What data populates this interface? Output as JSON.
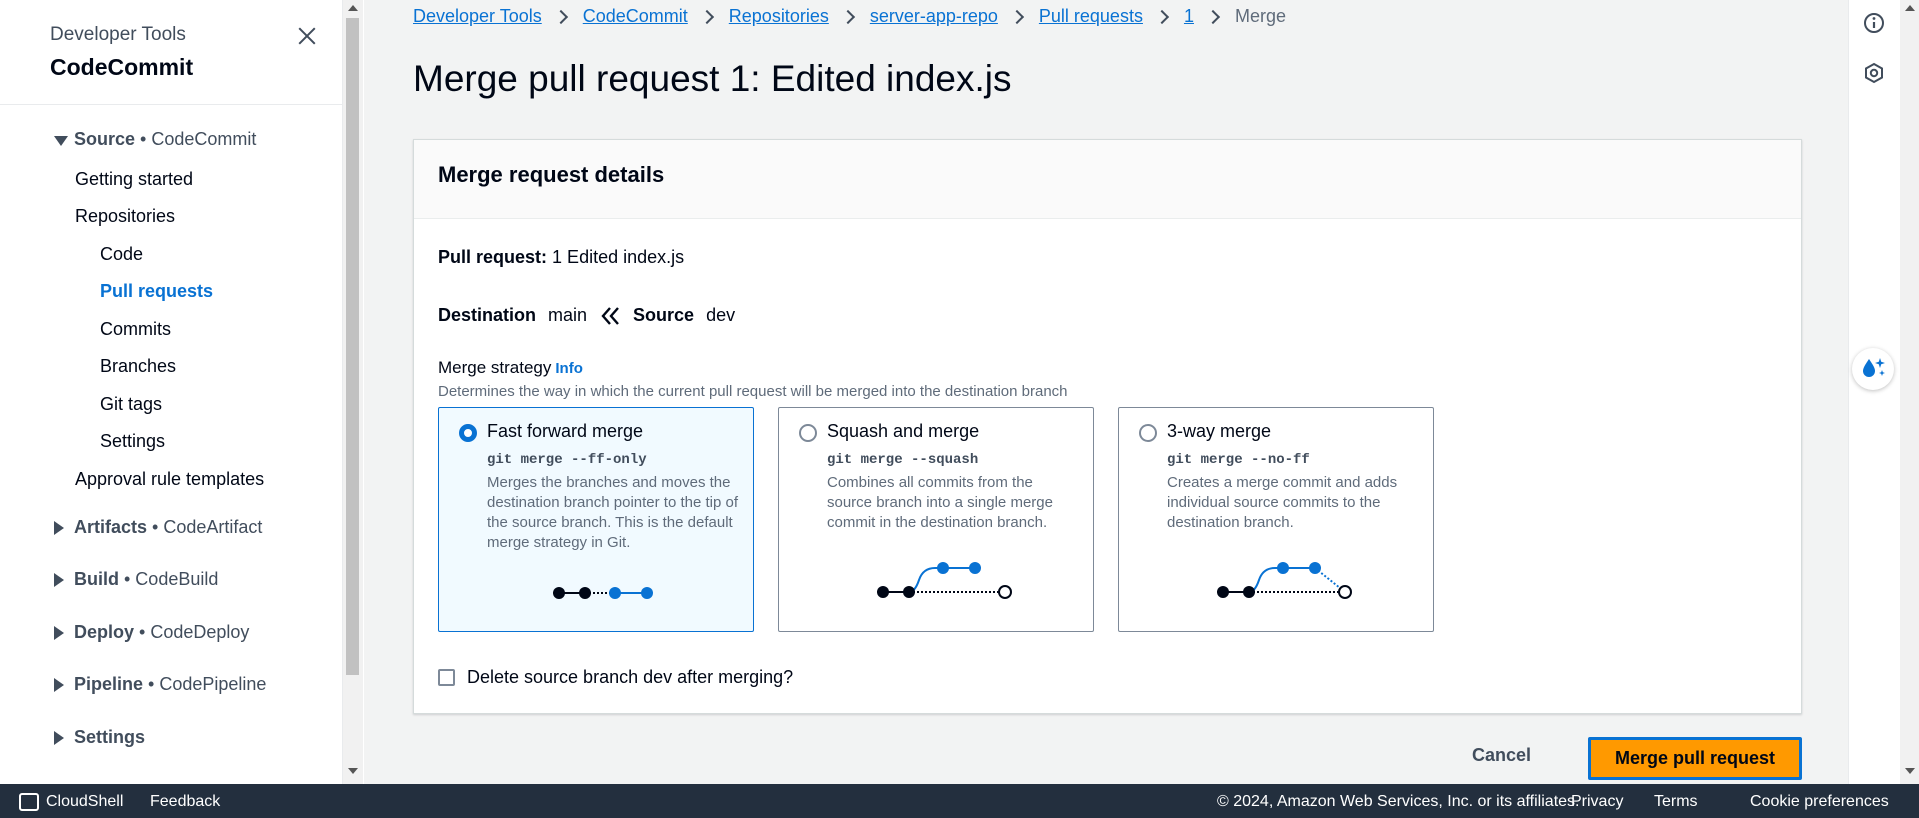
{
  "sidebar": {
    "super_title": "Developer Tools",
    "title": "CodeCommit",
    "source_section": {
      "label": "Source",
      "suffix": " • CodeCommit"
    },
    "items": [
      {
        "label": "Getting started"
      },
      {
        "label": "Repositories"
      },
      {
        "label": "Code"
      },
      {
        "label": "Pull requests"
      },
      {
        "label": "Commits"
      },
      {
        "label": "Branches"
      },
      {
        "label": "Git tags"
      },
      {
        "label": "Settings"
      },
      {
        "label": "Approval rule templates"
      }
    ],
    "sections": [
      {
        "label": "Artifacts",
        "suffix": " • CodeArtifact"
      },
      {
        "label": "Build",
        "suffix": " • CodeBuild"
      },
      {
        "label": "Deploy",
        "suffix": " • CodeDeploy"
      },
      {
        "label": "Pipeline",
        "suffix": " • CodePipeline"
      },
      {
        "label": "Settings",
        "suffix": ""
      }
    ]
  },
  "breadcrumb": [
    "Developer Tools",
    "CodeCommit",
    "Repositories",
    "server-app-repo",
    "Pull requests",
    "1"
  ],
  "breadcrumb_current": "Merge",
  "page_title": "Merge pull request 1: Edited index.js",
  "card": {
    "title": "Merge request details",
    "pull_request_label": "Pull request:",
    "pull_request_value": "1 Edited index.js",
    "destination_label": "Destination",
    "destination_value": "main",
    "source_label": "Source",
    "source_value": "dev",
    "strategy_label": "Merge strategy",
    "info_link": "Info",
    "strategy_description": "Determines the way in which the current pull request will be merged into the destination branch",
    "strategies": [
      {
        "label": "Fast forward merge",
        "command": "git merge --ff-only",
        "description": "Merges the branches and moves the destination branch pointer to the tip of the source branch. This is the default merge strategy in Git.",
        "selected": true
      },
      {
        "label": "Squash and merge",
        "command": "git merge --squash",
        "description": "Combines all commits from the source branch into a single merge commit in the destination branch.",
        "selected": false
      },
      {
        "label": "3-way merge",
        "command": "git merge --no-ff",
        "description": "Creates a merge commit and adds individual source commits to the destination branch.",
        "selected": false
      }
    ],
    "delete_branch_label": "Delete source branch dev after merging?"
  },
  "actions": {
    "cancel": "Cancel",
    "merge": "Merge pull request"
  },
  "footer": {
    "cloudshell": "CloudShell",
    "feedback": "Feedback",
    "copyright": "© 2024, Amazon Web Services, Inc. or its affiliates.",
    "privacy": "Privacy",
    "terms": "Terms",
    "cookies": "Cookie preferences"
  },
  "colors": {
    "accent": "#0972d3",
    "primary_button": "#ff9900",
    "footer_bg": "#232f3e"
  }
}
